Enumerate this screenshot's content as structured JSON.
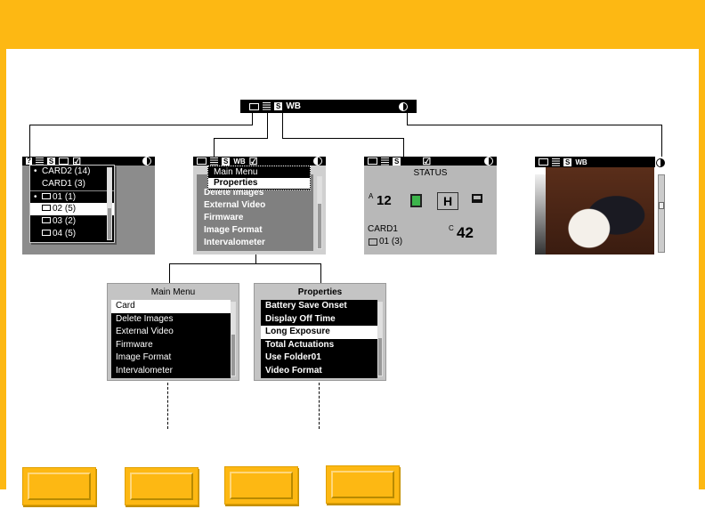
{
  "toolbar": {
    "icons": [
      "folder-icon",
      "menu-icon",
      "s-icon",
      "contrast-icon"
    ],
    "s_label": "S",
    "wb_label": "WB"
  },
  "screen_card": {
    "items": [
      {
        "label": "CARD2  (14)",
        "bullet": true,
        "selected": false
      },
      {
        "label": "CARD1  (3)",
        "bullet": false,
        "selected": false
      },
      {
        "label": "01  (1)",
        "bullet": true,
        "folder": true,
        "selected": false
      },
      {
        "label": "02  (5)",
        "bullet": false,
        "folder": true,
        "selected": true
      },
      {
        "label": "03  (2)",
        "bullet": false,
        "folder": true,
        "selected": false
      },
      {
        "label": "04  (5)",
        "bullet": false,
        "folder": true,
        "selected": false
      }
    ],
    "help_label": "?"
  },
  "screen_menu": {
    "popup": [
      "Main Menu",
      "Properties"
    ],
    "items": [
      "Delete Images",
      "External Video",
      "Firmware",
      "Image Format",
      "Intervalometer"
    ],
    "wb_label": "WB"
  },
  "screen_status": {
    "title": "STATUS",
    "a_label": "A",
    "a_value": "12",
    "h_label": "H",
    "card": "CARD1",
    "folder": "01  (3)",
    "c_label": "C",
    "c_value": "42"
  },
  "screen_image": {
    "wb_label": "WB"
  },
  "main_menu": {
    "title": "Main Menu",
    "items": [
      "Card",
      "Delete Images",
      "External Video",
      "Firmware",
      "Image Format",
      "Intervalometer"
    ],
    "selected": 0
  },
  "properties": {
    "title": "Properties",
    "items": [
      "Battery Save Onset",
      "Display Off Time",
      "Long Exposure",
      "Total Actuations",
      "Use Folder01",
      "Video Format"
    ],
    "selected": 2
  },
  "colors": {
    "frame": "#fdb813",
    "button": "#fdb813"
  }
}
